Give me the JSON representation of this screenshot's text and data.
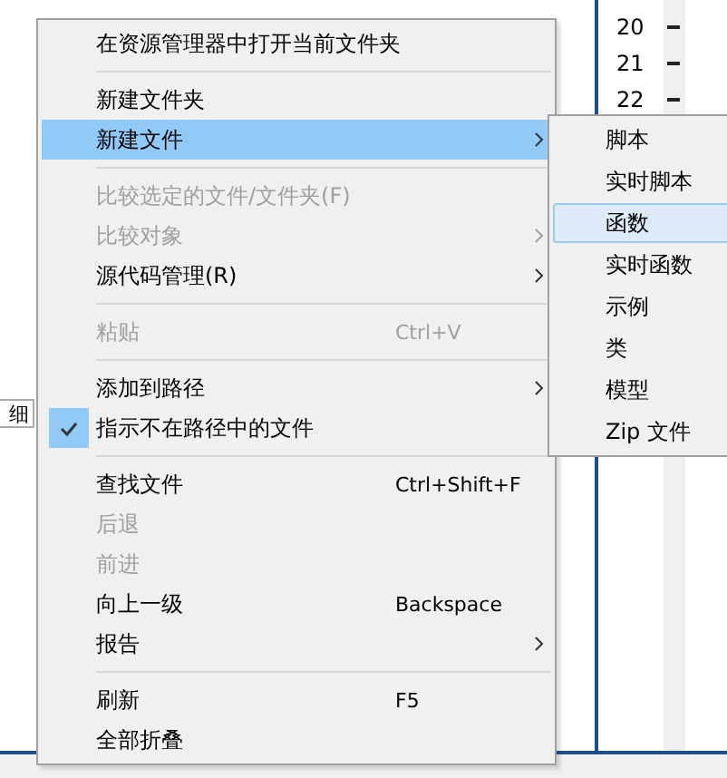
{
  "background": {
    "left_panel_label": "细",
    "line_numbers": [
      "20",
      "21",
      "22"
    ]
  },
  "context_menu": {
    "items": [
      {
        "kind": "item",
        "label": "在资源管理器中打开当前文件夹",
        "selected": false,
        "disabled": false,
        "checked": false,
        "has_submenu": false
      },
      {
        "kind": "separator"
      },
      {
        "kind": "item",
        "label": "新建文件夹",
        "selected": false,
        "disabled": false,
        "checked": false,
        "has_submenu": false
      },
      {
        "kind": "item",
        "label": "新建文件",
        "selected": true,
        "disabled": false,
        "checked": false,
        "has_submenu": true
      },
      {
        "kind": "separator"
      },
      {
        "kind": "item",
        "label": "比较选定的文件/文件夹(F)",
        "selected": false,
        "disabled": true,
        "checked": false,
        "has_submenu": false
      },
      {
        "kind": "item",
        "label": "比较对象",
        "selected": false,
        "disabled": true,
        "checked": false,
        "has_submenu": true
      },
      {
        "kind": "item",
        "label": "源代码管理(R)",
        "selected": false,
        "disabled": false,
        "checked": false,
        "has_submenu": true
      },
      {
        "kind": "separator"
      },
      {
        "kind": "item",
        "label": "粘贴",
        "shortcut": "Ctrl+V",
        "selected": false,
        "disabled": true,
        "checked": false,
        "has_submenu": false
      },
      {
        "kind": "separator"
      },
      {
        "kind": "item",
        "label": "添加到路径",
        "selected": false,
        "disabled": false,
        "checked": false,
        "has_submenu": true
      },
      {
        "kind": "item",
        "label": "指示不在路径中的文件",
        "selected": false,
        "disabled": false,
        "checked": true,
        "has_submenu": false
      },
      {
        "kind": "separator"
      },
      {
        "kind": "item",
        "label": "查找文件",
        "shortcut": "Ctrl+Shift+F",
        "selected": false,
        "disabled": false,
        "checked": false,
        "has_submenu": false
      },
      {
        "kind": "item",
        "label": "后退",
        "selected": false,
        "disabled": true,
        "checked": false,
        "has_submenu": false
      },
      {
        "kind": "item",
        "label": "前进",
        "selected": false,
        "disabled": true,
        "checked": false,
        "has_submenu": false
      },
      {
        "kind": "item",
        "label": "向上一级",
        "shortcut": "Backspace",
        "selected": false,
        "disabled": false,
        "checked": false,
        "has_submenu": false
      },
      {
        "kind": "item",
        "label": "报告",
        "selected": false,
        "disabled": false,
        "checked": false,
        "has_submenu": true
      },
      {
        "kind": "separator"
      },
      {
        "kind": "item",
        "label": "刷新",
        "shortcut": "F5",
        "selected": false,
        "disabled": false,
        "checked": false,
        "has_submenu": false
      },
      {
        "kind": "item",
        "label": "全部折叠",
        "selected": false,
        "disabled": false,
        "checked": false,
        "has_submenu": false
      }
    ]
  },
  "submenu": {
    "items": [
      {
        "label": "脚本",
        "selected": false
      },
      {
        "label": "实时脚本",
        "selected": false
      },
      {
        "label": "函数",
        "selected": true
      },
      {
        "label": "实时函数",
        "selected": false
      },
      {
        "label": "示例",
        "selected": false
      },
      {
        "label": "类",
        "selected": false
      },
      {
        "label": "模型",
        "selected": false
      },
      {
        "label": "Zip 文件",
        "selected": false
      }
    ]
  }
}
